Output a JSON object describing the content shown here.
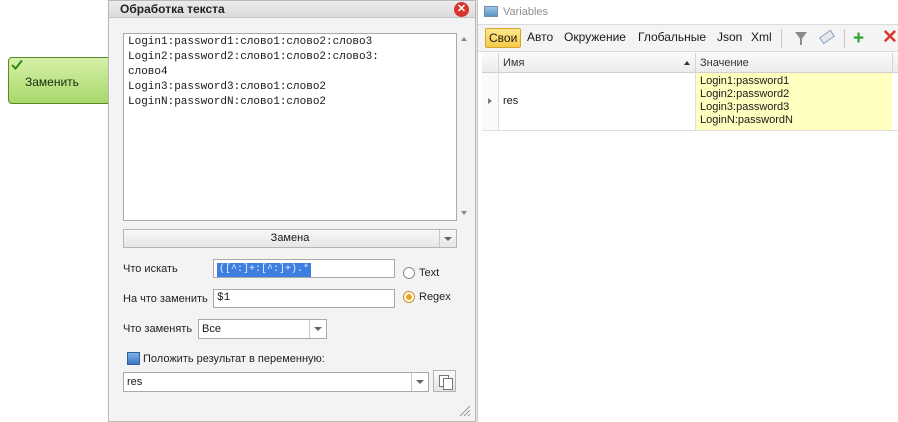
{
  "canvas": {
    "node_label": "Заменить"
  },
  "dialog": {
    "title": "Обработка текста",
    "text_lines": [
      "Login1:password1:слово1:слово2:слово3",
      "Login2:password2:слово1:слово2:слово3:",
      "слово4",
      "Login3:password3:слово1:слово2",
      "LoginN:passwordN:слово1:слово2"
    ],
    "mode_value": "Замена",
    "find_label": "Что искать",
    "find_value": "([^:]+:[^:]+).*",
    "replace_label": "На что заменить",
    "replace_value": "$1",
    "radio_text_label": "Text",
    "radio_regex_label": "Regex",
    "what_label": "Что заменять",
    "what_value": "Все",
    "put_label": "Положить результат в переменную:",
    "var_value": "res"
  },
  "variables": {
    "title": "Variables",
    "tabs": [
      "Свои",
      "Авто",
      "Окружение",
      "Глобальные",
      "Json",
      "Xml"
    ],
    "columns": {
      "name": "Имя",
      "value": "Значение"
    },
    "rows": [
      {
        "name": "res",
        "value_lines": [
          "Login1:password1",
          "Login2:password2",
          "Login3:password3",
          "LoginN:passwordN"
        ]
      }
    ]
  }
}
